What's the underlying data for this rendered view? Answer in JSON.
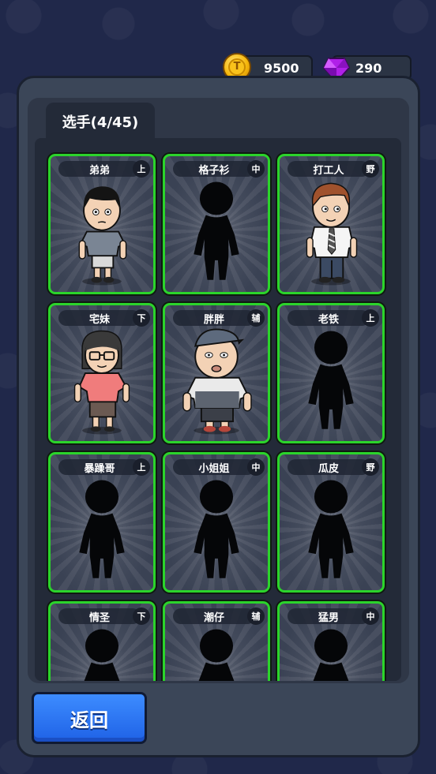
{
  "currency": {
    "coins": "9500",
    "gems": "290",
    "coin_icon": "coin-icon",
    "gem_icon": "gem-icon"
  },
  "tab": {
    "label": "选手(4/45)"
  },
  "players": [
    {
      "name": "弟弟",
      "role": "上",
      "unlocked": true,
      "figure": "boy"
    },
    {
      "name": "格子衫",
      "role": "中",
      "unlocked": false,
      "figure": "silhouette"
    },
    {
      "name": "打工人",
      "role": "野",
      "unlocked": true,
      "figure": "worker"
    },
    {
      "name": "宅妹",
      "role": "下",
      "unlocked": true,
      "figure": "girl"
    },
    {
      "name": "胖胖",
      "role": "辅",
      "unlocked": true,
      "figure": "chubby"
    },
    {
      "name": "老铁",
      "role": "上",
      "unlocked": false,
      "figure": "silhouette"
    },
    {
      "name": "暴躁哥",
      "role": "上",
      "unlocked": false,
      "figure": "silhouette"
    },
    {
      "name": "小姐姐",
      "role": "中",
      "unlocked": false,
      "figure": "silhouette"
    },
    {
      "name": "瓜皮",
      "role": "野",
      "unlocked": false,
      "figure": "silhouette"
    },
    {
      "name": "情圣",
      "role": "下",
      "unlocked": false,
      "figure": "silhouette"
    },
    {
      "name": "潮仔",
      "role": "辅",
      "unlocked": false,
      "figure": "silhouette"
    },
    {
      "name": "猛男",
      "role": "中",
      "unlocked": false,
      "figure": "silhouette"
    }
  ],
  "back_button": {
    "label": "返回"
  },
  "colors": {
    "card_border": "#2bd42b",
    "button": "#2f7bf5",
    "gem": "#a020e0",
    "coin": "#f6b80c"
  }
}
